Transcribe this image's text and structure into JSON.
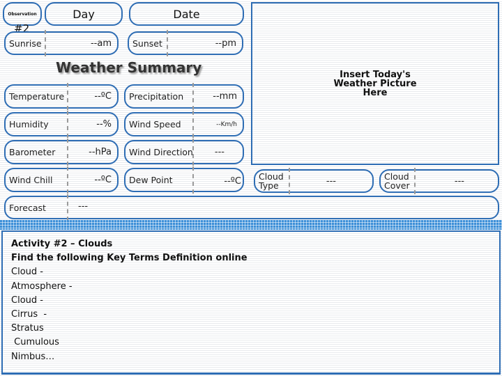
{
  "header": {
    "observation_label": "Observation",
    "observation_number": "#2",
    "day_label": "Day",
    "date_label": "Date"
  },
  "sun": {
    "sunrise": {
      "label": "Sunrise",
      "value": "--am"
    },
    "sunset": {
      "label": "Sunset",
      "value": "--pm"
    }
  },
  "summary": {
    "title": "Weather Summary",
    "fields": {
      "temperature": {
        "label": "Temperature",
        "value": "--ºC"
      },
      "precipitation": {
        "label": "Precipitation",
        "value": "--mm"
      },
      "humidity": {
        "label": "Humidity",
        "value": "--%"
      },
      "wind_speed": {
        "label": "Wind Speed",
        "value": "--Km/h"
      },
      "barometer": {
        "label": "Barometer",
        "value": "--hPa"
      },
      "wind_direction": {
        "label": "Wind Direction",
        "value": "---"
      },
      "wind_chill": {
        "label": "Wind Chill",
        "value": "--ºC"
      },
      "dew_point": {
        "label": "Dew Point",
        "value": "--ºC"
      },
      "cloud_type": {
        "label": "Cloud\nType",
        "value": "---"
      },
      "cloud_cover": {
        "label": "Cloud\nCover",
        "value": "---"
      },
      "forecast": {
        "label": "Forecast",
        "value": "---"
      }
    }
  },
  "picture": {
    "placeholder": "Insert Today's\nWeather Picture\nHere"
  },
  "activity": {
    "title": "Activity #2 – Clouds",
    "instruction": "Find the following Key Terms Definition online",
    "terms": [
      "Cloud -",
      "Atmosphere -",
      "Cloud -",
      "Cirrus  -",
      "Stratus",
      " Cumulous",
      "Nimbus…"
    ]
  },
  "colors": {
    "accent": "#2e6db4",
    "band": "#3c8fd8"
  }
}
